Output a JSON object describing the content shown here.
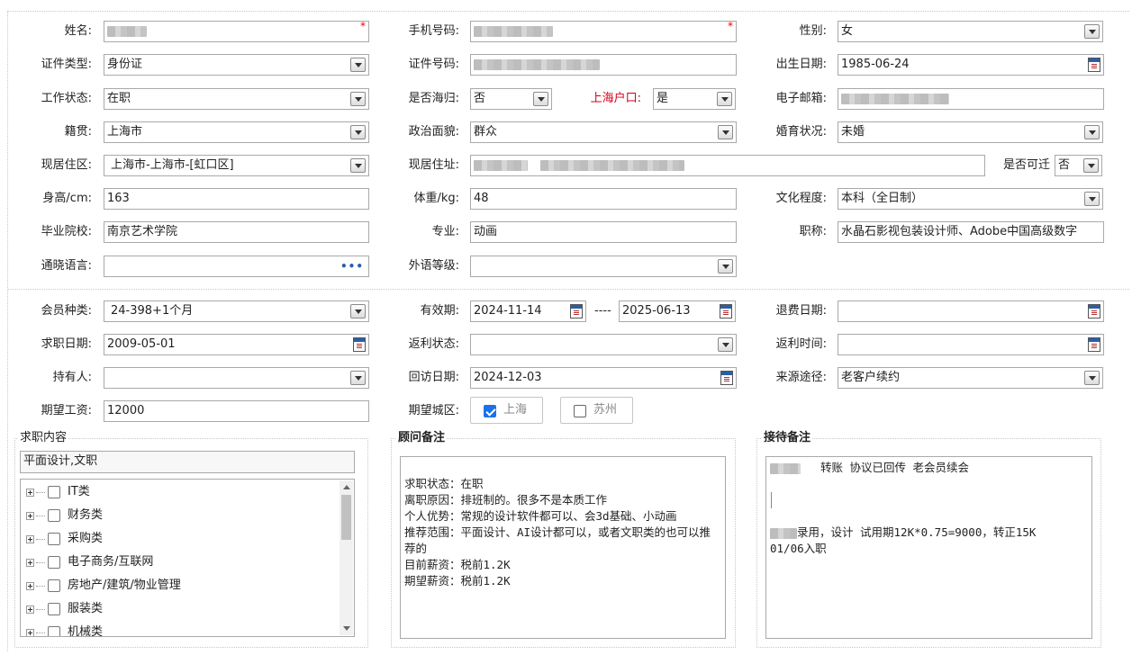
{
  "basic": {
    "name": {
      "label": "姓名:",
      "value": ""
    },
    "mobile": {
      "label": "手机号码:",
      "value": ""
    },
    "gender": {
      "label": "性别:",
      "value": "女"
    },
    "id_type": {
      "label": "证件类型:",
      "value": "身份证"
    },
    "id_number": {
      "label": "证件号码:",
      "value": ""
    },
    "birth_date": {
      "label": "出生日期:",
      "value": "1985-06-24"
    },
    "work_status": {
      "label": "工作状态:",
      "value": "在职"
    },
    "returnee": {
      "label": "是否海归:",
      "value": "否"
    },
    "sh_hukou": {
      "label": "上海户口:",
      "value": "是"
    },
    "email": {
      "label": "电子邮箱:",
      "value": ""
    },
    "native_place": {
      "label": "籍贯:",
      "value": "上海市"
    },
    "political": {
      "label": "政治面貌:",
      "value": "群众"
    },
    "marital": {
      "label": "婚育状况:",
      "value": "未婚"
    },
    "residence_area": {
      "label": "现居住区:",
      "value": "上海市-上海市-[虹口区]"
    },
    "residence_address": {
      "label": "现居住址:",
      "value": ""
    },
    "relocatable": {
      "label": "是否可迁",
      "value": "否"
    },
    "height": {
      "label": "身高/cm:",
      "value": "163"
    },
    "weight": {
      "label": "体重/kg:",
      "value": "48"
    },
    "education": {
      "label": "文化程度:",
      "value": "本科（全日制）"
    },
    "school": {
      "label": "毕业院校:",
      "value": "南京艺术学院"
    },
    "major": {
      "label": "专业:",
      "value": "动画"
    },
    "title": {
      "label": "职称:",
      "value": "水晶石影视包装设计师、Adobe中国高级数字"
    },
    "languages": {
      "label": "通晓语言:",
      "value": ""
    },
    "foreign_level": {
      "label": "外语等级:",
      "value": ""
    }
  },
  "membership": {
    "member_type": {
      "label": "会员种类:",
      "value": "24-398+1个月"
    },
    "valid_period": {
      "label": "有效期:",
      "start": "2024-11-14",
      "separator": "----",
      "end": "2025-06-13"
    },
    "refund_date": {
      "label": "退费日期:",
      "value": ""
    },
    "job_search_date": {
      "label": "求职日期:",
      "value": "2009-05-01"
    },
    "rebate_status": {
      "label": "返利状态:",
      "value": ""
    },
    "rebate_time": {
      "label": "返利时间:",
      "value": ""
    },
    "holder": {
      "label": "持有人:",
      "value": ""
    },
    "follow_up_date": {
      "label": "回访日期:",
      "value": "2024-12-03"
    },
    "source": {
      "label": "来源途径:",
      "value": "老客户续约"
    },
    "expected_salary": {
      "label": "期望工资:",
      "value": "12000"
    },
    "expected_city": {
      "label": "期望城区:",
      "options": [
        {
          "label": "上海",
          "checked": true
        },
        {
          "label": "苏州",
          "checked": false
        }
      ]
    }
  },
  "job_content": {
    "title": "求职内容",
    "selected": "平面设计,文职",
    "categories": [
      "IT类",
      "财务类",
      "采购类",
      "电子商务/互联网",
      "房地产/建筑/物业管理",
      "服装类",
      "机械类"
    ]
  },
  "consultant_notes": {
    "title": "顾问备注",
    "text": "\n求职状态：在职\n离职原因：排班制的。很多不是本质工作\n个人优势：常规的设计软件都可以、会3d基础、小动画\n推荐范围：平面设计、AI设计都可以，或者文职类的也可以推荐的\n目前薪资：税前1.2K\n期望薪资：税前1.2K"
  },
  "reception_notes": {
    "title": "接待备注",
    "line1": "转账    协议已回传 老会员续会",
    "line2": "录用，设计  试用期12K*0.75=9000，转正15K",
    "line3": "01/06入职"
  },
  "colors": {
    "accent": "#1a73e8",
    "required": "#e00000",
    "warn_label": "#d0021b"
  }
}
